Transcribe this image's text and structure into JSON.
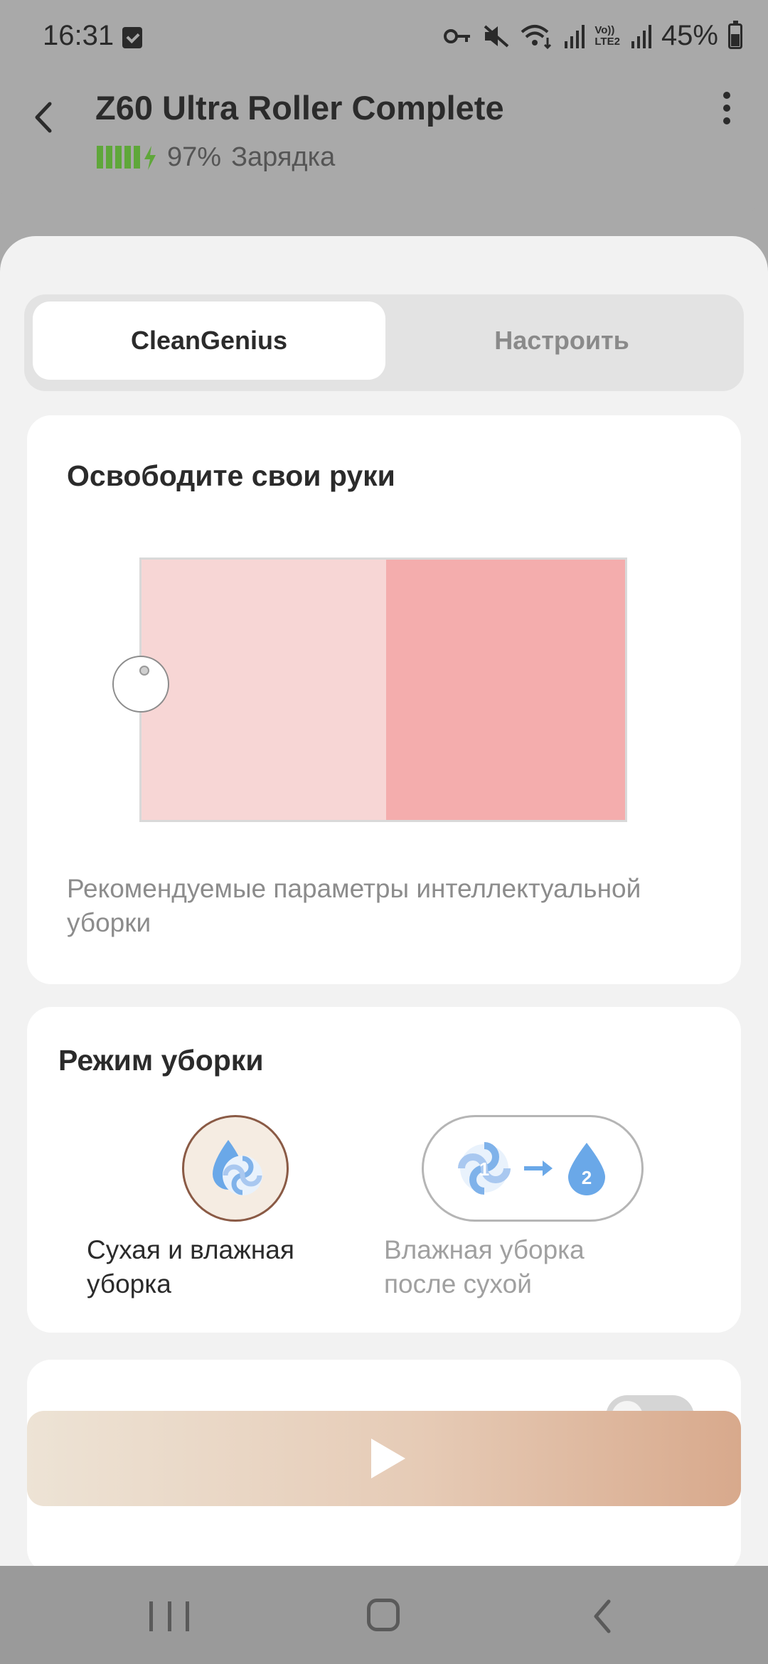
{
  "status_bar": {
    "time": "16:31",
    "battery_percent": "45%",
    "icons": [
      "notification-check-icon",
      "vpn-key-icon",
      "mute-icon",
      "wifi-icon",
      "signal-icon",
      "volte-icon",
      "signal-icon",
      "battery-icon"
    ],
    "volte_label_top": "Vo))",
    "volte_label_bottom": "LTE2"
  },
  "header": {
    "title": "Z60 Ultra Roller Complete",
    "battery_level": "97%",
    "battery_status": "Зарядка",
    "battery_cells": 5,
    "battery_color": "#5fa73a"
  },
  "tabs": [
    {
      "label": "CleanGenius",
      "active": true
    },
    {
      "label": "Настроить",
      "active": false
    }
  ],
  "clean_genius_card": {
    "title": "Освободите свои руки",
    "description": "Рекомендуемые параметры интеллектуальной уборки",
    "map_colors": {
      "zone_a": "#f7d6d5",
      "zone_b": "#f4adad"
    }
  },
  "mode_card": {
    "title": "Режим уборки",
    "options": [
      {
        "label": "Сухая и влажная уборка",
        "selected": true,
        "icon": "vacuum-and-mop-icon"
      },
      {
        "label": "Влажная уборка после сухой",
        "selected": false,
        "icon": "vacuum-then-mop-icon",
        "step1": "1",
        "step2": "2"
      }
    ]
  },
  "start_button": {
    "icon": "play-icon"
  },
  "nav_bar": {
    "icons": [
      "recent-apps-icon",
      "home-icon",
      "back-icon"
    ]
  },
  "accent_color": "#d8a98c"
}
